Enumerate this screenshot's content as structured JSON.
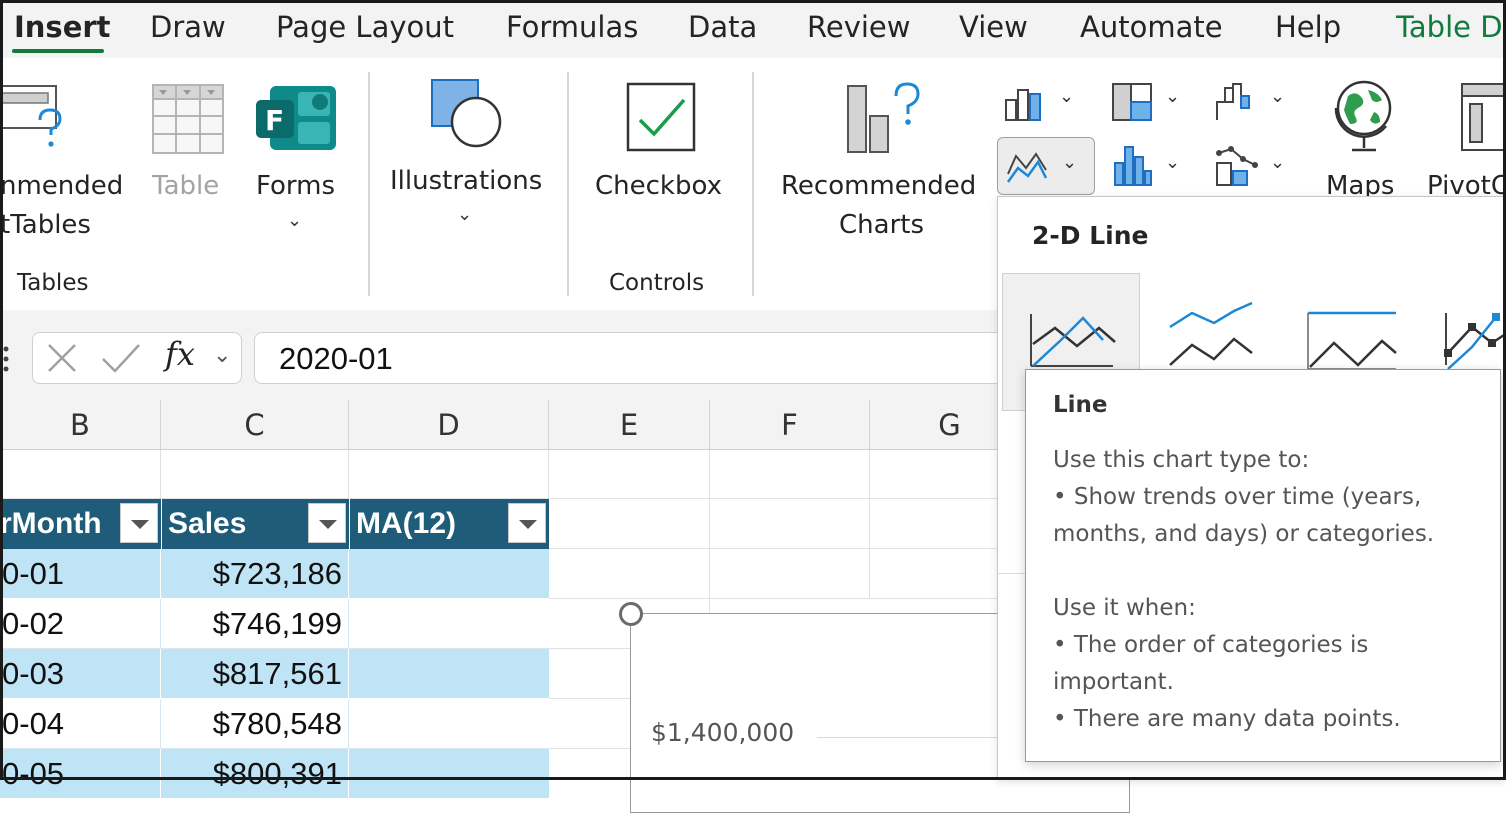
{
  "tabs": [
    {
      "label": "Insert",
      "active": true
    },
    {
      "label": "Draw"
    },
    {
      "label": "Page Layout"
    },
    {
      "label": "Formulas"
    },
    {
      "label": "Data"
    },
    {
      "label": "Review"
    },
    {
      "label": "View"
    },
    {
      "label": "Automate"
    },
    {
      "label": "Help"
    },
    {
      "label": "Table D"
    }
  ],
  "ribbon": {
    "recommended_pivottables": {
      "line1": "nmended",
      "line2": "tTables"
    },
    "table": {
      "label": "Table"
    },
    "forms": {
      "label": "Forms"
    },
    "illustrations": {
      "label": "Illustrations"
    },
    "checkbox": {
      "label": "Checkbox"
    },
    "recommended_charts": {
      "line1": "Recommended",
      "line2": "Charts"
    },
    "maps": {
      "label": "Maps"
    },
    "pivotchart": {
      "label": "PivotC"
    },
    "groups": {
      "tables": "Tables",
      "controls": "Controls"
    }
  },
  "formula_bar": {
    "fx": "fx",
    "value": "2020-01"
  },
  "columns": [
    "B",
    "C",
    "D",
    "E",
    "F",
    "G"
  ],
  "table": {
    "headers": [
      "rMonth",
      "Sales",
      "MA(12)"
    ],
    "rows": [
      {
        "month": "0-01",
        "sales": "$723,186",
        "ma": ""
      },
      {
        "month": "0-02",
        "sales": "$746,199",
        "ma": ""
      },
      {
        "month": "0-03",
        "sales": "$817,561",
        "ma": ""
      },
      {
        "month": "0-04",
        "sales": "$780,548",
        "ma": ""
      },
      {
        "month": "0-05",
        "sales": "$800,391",
        "ma": ""
      }
    ]
  },
  "chart": {
    "y_label": "$1,400,000"
  },
  "dropdown": {
    "title": "2-D Line"
  },
  "tooltip": {
    "title": "Line",
    "line1": "Use this chart type to:",
    "line2": "• Show trends over time (years,",
    "line3": "months, and days) or categories.",
    "line4": "Use it when:",
    "line5": "• The order of categories is",
    "line6": "important.",
    "line7": "• There are many data points."
  },
  "colors": {
    "accent": "#117a3d",
    "table_header": "#1f5c7a",
    "table_band": "#bfe4f5",
    "chart_blue": "#1e88d6"
  }
}
